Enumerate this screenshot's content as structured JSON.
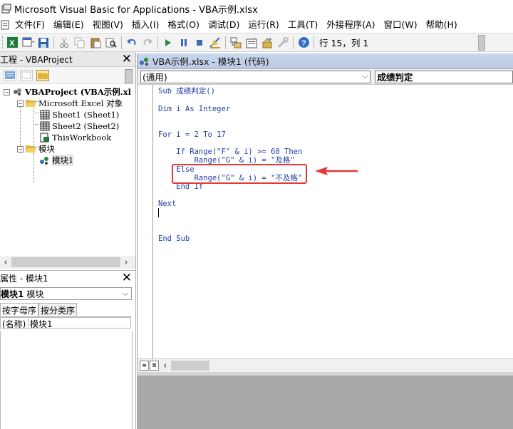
{
  "titlebar": {
    "title": "Microsoft Visual Basic for Applications - VBA示例.xlsx"
  },
  "menu": [
    {
      "label": "文件(F)"
    },
    {
      "label": "编辑(E)"
    },
    {
      "label": "视图(V)"
    },
    {
      "label": "插入(I)"
    },
    {
      "label": "格式(O)"
    },
    {
      "label": "调试(D)"
    },
    {
      "label": "运行(R)"
    },
    {
      "label": "工具(T)"
    },
    {
      "label": "外接程序(A)"
    },
    {
      "label": "窗口(W)"
    },
    {
      "label": "帮助(H)"
    }
  ],
  "toolbar": {
    "icons": [
      "excel-view-icon",
      "insert-userform-icon",
      "save-icon",
      "cut-icon",
      "copy-icon",
      "paste-icon",
      "find-icon",
      "undo-icon",
      "redo-icon",
      "run-icon",
      "break-icon",
      "reset-icon",
      "design-mode-icon",
      "project-explorer-icon",
      "properties-window-icon",
      "object-browser-icon",
      "toolbox-icon",
      "help-icon"
    ],
    "position": "行 15，列 1"
  },
  "project_pane": {
    "title": "工程 - VBAProject",
    "tree": {
      "project": "VBAProject (VBA示例.xl",
      "excel_objects": "Microsoft Excel 对象",
      "sheet1": "Sheet1 (Sheet1)",
      "sheet2": "Sheet2 (Sheet2)",
      "thisworkbook": "ThisWorkbook",
      "modules": "模块",
      "module1": "模块1"
    }
  },
  "props_pane": {
    "title": "属性 - 模块1",
    "object_name": "模块1",
    "object_type": "模块",
    "tab_alpha": "按字母序",
    "tab_category": "按分类序",
    "row_key": "(名称)",
    "row_value": "模块1"
  },
  "code_window": {
    "title": "VBA示例.xlsx - 模块1 (代码)",
    "object_combo": "(通用)",
    "proc_combo": "成绩判定",
    "lines": [
      "Sub 成绩判定()",
      "Dim i As Integer",
      "For i = 2 To 17",
      "    If Range(\"F\" & i) >= 60 Then",
      "        Range(\"G\" & i) = \"及格\"",
      "    Else",
      "        Range(\"G\" & i) = \"不及格\"",
      "    End If",
      "Next",
      "End Sub"
    ]
  },
  "colors": {
    "annotation": "#e53935",
    "keyword": "#1f3fa8",
    "code_title_bg": "#c8d7ec"
  }
}
